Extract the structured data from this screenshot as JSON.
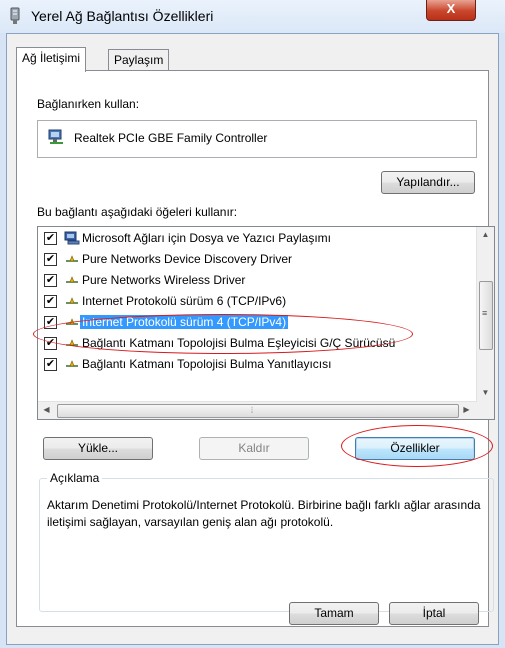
{
  "window": {
    "title": "Yerel Ağ Bağlantısı Özellikleri",
    "close_label": "X"
  },
  "tabs": [
    {
      "label": "Ağ İletişimi",
      "active": true
    },
    {
      "label": "Paylaşım",
      "active": false
    }
  ],
  "connect_using": {
    "label": "Bağlanırken kullan:",
    "adapter_name": "Realtek PCIe GBE Family Controller",
    "configure_button": "Yapılandır..."
  },
  "items_section": {
    "label": "Bu bağlantı aşağıdaki öğeleri kullanır:",
    "items": [
      {
        "label": "Microsoft Ağları için Dosya ve Yazıcı Paylaşımı",
        "checked": true,
        "icon": "network-service-icon",
        "selected": false
      },
      {
        "label": "Pure Networks Device Discovery Driver",
        "checked": true,
        "icon": "protocol-icon",
        "selected": false
      },
      {
        "label": "Pure Networks Wireless Driver",
        "checked": true,
        "icon": "protocol-icon",
        "selected": false
      },
      {
        "label": "Internet Protokolü sürüm 6 (TCP/IPv6)",
        "checked": true,
        "icon": "protocol-icon",
        "selected": false
      },
      {
        "label": "Internet Protokolü sürüm 4 (TCP/IPv4)",
        "checked": true,
        "icon": "protocol-icon",
        "selected": true
      },
      {
        "label": "Bağlantı Katmanı Topolojisi Bulma Eşleyicisi G/Ç Sürücüsü",
        "checked": true,
        "icon": "protocol-icon",
        "selected": false
      },
      {
        "label": "Bağlantı Katmanı Topolojisi Bulma Yanıtlayıcısı",
        "checked": true,
        "icon": "protocol-icon",
        "selected": false
      }
    ],
    "check_mark": "✔"
  },
  "buttons": {
    "install": "Yükle...",
    "uninstall": "Kaldır",
    "properties": "Özellikler",
    "ok": "Tamam",
    "cancel": "İptal"
  },
  "description": {
    "legend": "Açıklama",
    "text": "Aktarım Denetimi Protokolü/Internet Protokolü. Birbirine bağlı farklı ağlar arasında iletişimi sağlayan, varsayılan geniş alan ağı protokolü."
  },
  "colors": {
    "selection": "#3399ff",
    "annotation": "#d91b1b",
    "close_button": "#c9462c"
  }
}
